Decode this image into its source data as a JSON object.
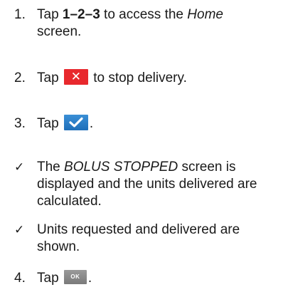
{
  "steps": [
    {
      "marker": "1.",
      "text_tap": "Tap ",
      "keys": "1–2–3",
      "text_mid": " to access the ",
      "screen_name": "Home",
      "text_end": "screen."
    },
    {
      "marker": "2.",
      "text_tap": "Tap",
      "stop_icon": "✕",
      "text_end": " to stop delivery."
    },
    {
      "marker": "3.",
      "text_tap": "Tap",
      "text_end": "."
    },
    {
      "marker": "✓",
      "text_a": "The ",
      "screen_name": "BOLUS STOPPED",
      "text_b": " screen is displayed and the units delivered are calculated."
    },
    {
      "marker": "✓",
      "text": "Units requested and delivered are shown."
    },
    {
      "marker": "4.",
      "text_tap": "Tap",
      "ok_label": "OK",
      "text_end": "."
    }
  ],
  "colors": {
    "stop_button": "#e8282d",
    "confirm_button": "#2a7fc8",
    "ok_button": "#8a8a8a"
  }
}
